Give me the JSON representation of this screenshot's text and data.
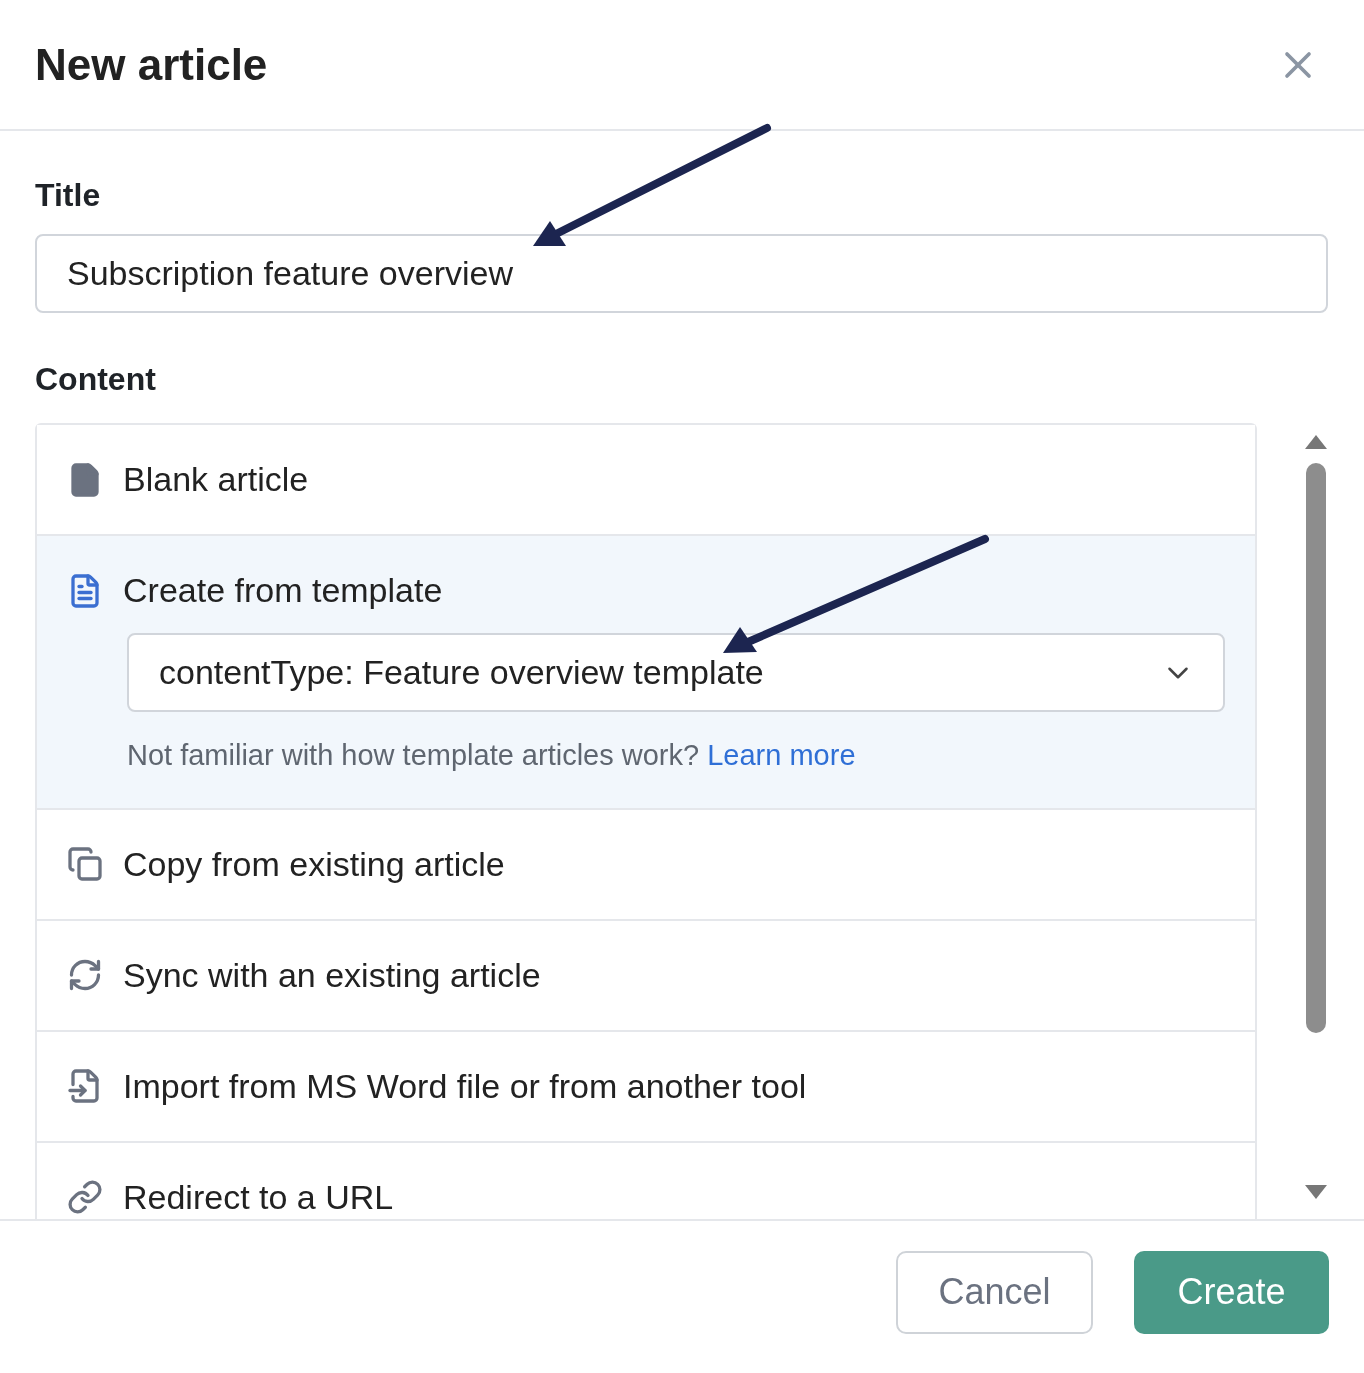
{
  "dialog": {
    "title": "New article"
  },
  "title_field": {
    "label": "Title",
    "value": "Subscription feature overview"
  },
  "content": {
    "label": "Content",
    "options": [
      {
        "kind": "blank",
        "label": "Blank article",
        "selected": false
      },
      {
        "kind": "template",
        "label": "Create from template",
        "selected": true,
        "template_select": {
          "value": "contentType: Feature overview template"
        },
        "help": {
          "text": "Not familiar with how template articles work?",
          "link": "Learn more"
        }
      },
      {
        "kind": "copy",
        "label": "Copy from existing article",
        "selected": false
      },
      {
        "kind": "sync",
        "label": "Sync with an existing article",
        "selected": false
      },
      {
        "kind": "import",
        "label": "Import from MS Word file or from another tool",
        "selected": false
      },
      {
        "kind": "redirect",
        "label": "Redirect to a URL",
        "selected": false
      }
    ]
  },
  "buttons": [
    {
      "kind": "secondary",
      "label": "Cancel"
    },
    {
      "kind": "primary",
      "label": "Create"
    }
  ]
}
